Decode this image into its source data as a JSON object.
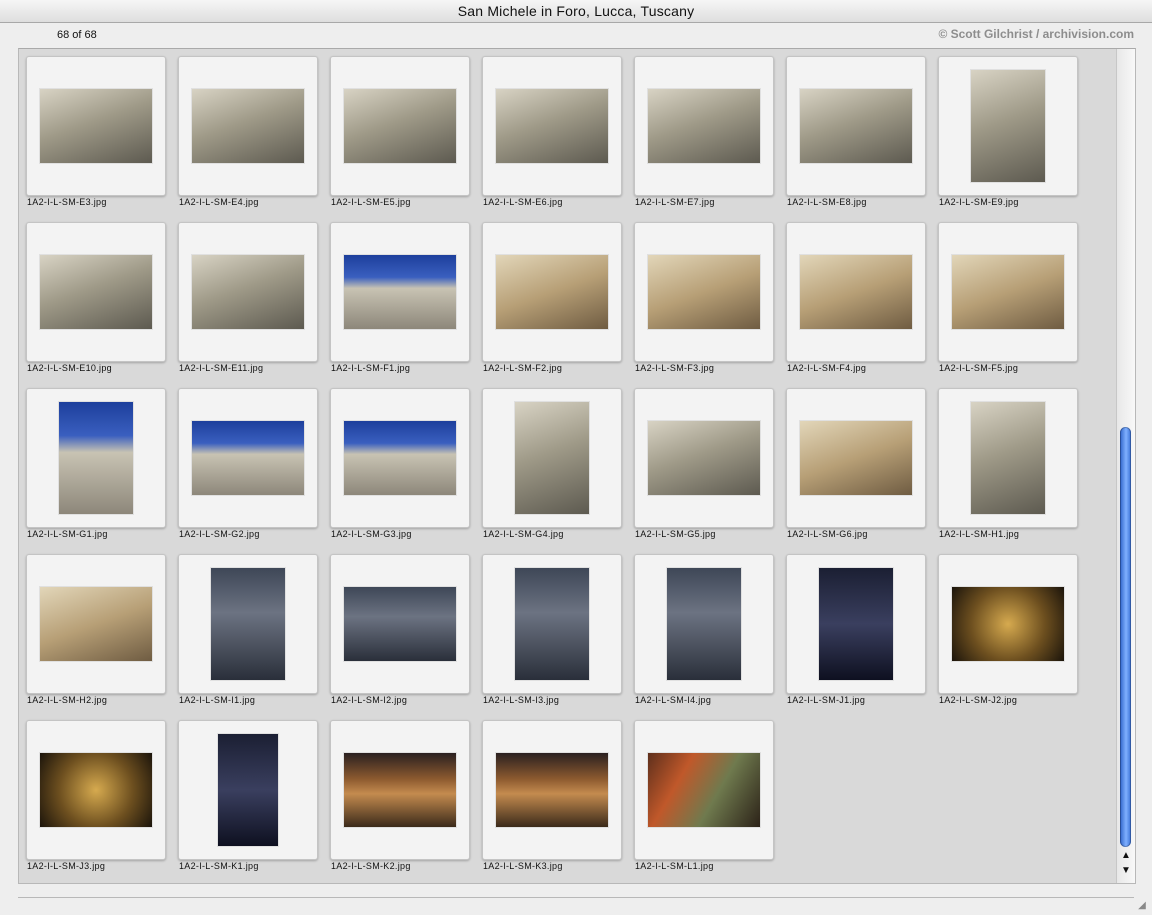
{
  "window": {
    "title": "San Michele in Foro, Lucca, Tuscany"
  },
  "toolbar": {
    "count_label": "68 of 68",
    "credit": "© Scott Gilchrist / archivision.com"
  },
  "thumbnails": [
    {
      "filename": "1A2-I-L-SM-E3.jpg",
      "orientation": "land",
      "tone": "stone"
    },
    {
      "filename": "1A2-I-L-SM-E4.jpg",
      "orientation": "land",
      "tone": "stone"
    },
    {
      "filename": "1A2-I-L-SM-E5.jpg",
      "orientation": "land",
      "tone": "stone"
    },
    {
      "filename": "1A2-I-L-SM-E6.jpg",
      "orientation": "land",
      "tone": "stone"
    },
    {
      "filename": "1A2-I-L-SM-E7.jpg",
      "orientation": "land",
      "tone": "stone"
    },
    {
      "filename": "1A2-I-L-SM-E8.jpg",
      "orientation": "land",
      "tone": "stone"
    },
    {
      "filename": "1A2-I-L-SM-E9.jpg",
      "orientation": "port",
      "tone": "stone"
    },
    {
      "filename": "1A2-I-L-SM-E10.jpg",
      "orientation": "land",
      "tone": "stone"
    },
    {
      "filename": "1A2-I-L-SM-E11.jpg",
      "orientation": "land",
      "tone": "stone"
    },
    {
      "filename": "1A2-I-L-SM-F1.jpg",
      "orientation": "land",
      "tone": "blue"
    },
    {
      "filename": "1A2-I-L-SM-F2.jpg",
      "orientation": "land",
      "tone": "warm"
    },
    {
      "filename": "1A2-I-L-SM-F3.jpg",
      "orientation": "land",
      "tone": "warm"
    },
    {
      "filename": "1A2-I-L-SM-F4.jpg",
      "orientation": "land",
      "tone": "warm"
    },
    {
      "filename": "1A2-I-L-SM-F5.jpg",
      "orientation": "land",
      "tone": "warm"
    },
    {
      "filename": "1A2-I-L-SM-G1.jpg",
      "orientation": "port",
      "tone": "blue"
    },
    {
      "filename": "1A2-I-L-SM-G2.jpg",
      "orientation": "land",
      "tone": "blue"
    },
    {
      "filename": "1A2-I-L-SM-G3.jpg",
      "orientation": "land",
      "tone": "blue"
    },
    {
      "filename": "1A2-I-L-SM-G4.jpg",
      "orientation": "port",
      "tone": "stone"
    },
    {
      "filename": "1A2-I-L-SM-G5.jpg",
      "orientation": "land",
      "tone": "stone"
    },
    {
      "filename": "1A2-I-L-SM-G6.jpg",
      "orientation": "land",
      "tone": "warm"
    },
    {
      "filename": "1A2-I-L-SM-H1.jpg",
      "orientation": "port",
      "tone": "stone"
    },
    {
      "filename": "1A2-I-L-SM-H2.jpg",
      "orientation": "land",
      "tone": "warm"
    },
    {
      "filename": "1A2-I-L-SM-I1.jpg",
      "orientation": "port",
      "tone": "dark"
    },
    {
      "filename": "1A2-I-L-SM-I2.jpg",
      "orientation": "land",
      "tone": "dark"
    },
    {
      "filename": "1A2-I-L-SM-I3.jpg",
      "orientation": "port",
      "tone": "dark"
    },
    {
      "filename": "1A2-I-L-SM-I4.jpg",
      "orientation": "port",
      "tone": "dark"
    },
    {
      "filename": "1A2-I-L-SM-J1.jpg",
      "orientation": "port",
      "tone": "night"
    },
    {
      "filename": "1A2-I-L-SM-J2.jpg",
      "orientation": "land",
      "tone": "gold"
    },
    {
      "filename": "1A2-I-L-SM-J3.jpg",
      "orientation": "land",
      "tone": "gold"
    },
    {
      "filename": "1A2-I-L-SM-K1.jpg",
      "orientation": "ultra",
      "tone": "night"
    },
    {
      "filename": "1A2-I-L-SM-K2.jpg",
      "orientation": "land",
      "tone": "red"
    },
    {
      "filename": "1A2-I-L-SM-K3.jpg",
      "orientation": "land",
      "tone": "red"
    },
    {
      "filename": "1A2-I-L-SM-L1.jpg",
      "orientation": "land",
      "tone": "fresco"
    }
  ],
  "scrollbar": {
    "up_arrow": "▲",
    "down_arrow": "▼"
  },
  "resize_grip": "◢"
}
